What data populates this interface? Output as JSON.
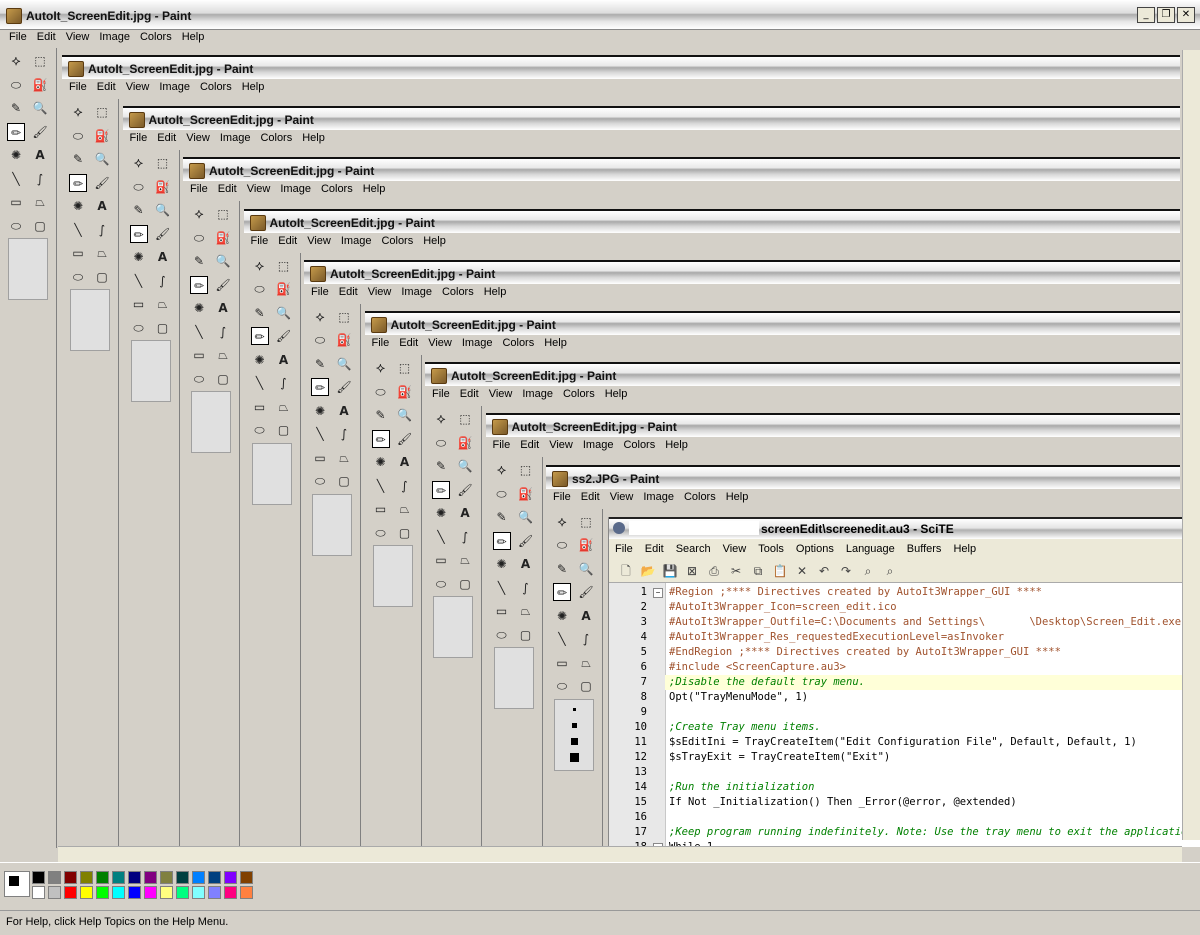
{
  "window": {
    "title": "AutoIt_ScreenEdit.jpg - Paint"
  },
  "menu": [
    "File",
    "Edit",
    "View",
    "Image",
    "Colors",
    "Help"
  ],
  "nested_titles": [
    "AutoIt_ScreenEdit.jpg - Paint",
    "AutoIt_ScreenEdit.jpg - Paint",
    "AutoIt_ScreenEdit.jpg - Paint",
    "AutoIt_ScreenEdit.jpg - Paint",
    "AutoIt_ScreenEdit.jpg - Paint",
    "AutoIt_ScreenEdit.jpg - Paint",
    "AutoIt_ScreenEdit.jpg - Paint",
    "AutoIt_ScreenEdit.jpg - Paint",
    "ss2.JPG - Paint"
  ],
  "scite": {
    "title": "screenEdit\\screenedit.au3 - SciTE",
    "menu": [
      "File",
      "Edit",
      "Search",
      "View",
      "Tools",
      "Options",
      "Language",
      "Buffers",
      "Help"
    ],
    "lines": [
      {
        "n": "1",
        "text": "#Region ;**** Directives created by AutoIt3Wrapper_GUI ****",
        "cls": "c-dir"
      },
      {
        "n": "2",
        "text": "#AutoIt3Wrapper_Icon=screen_edit.ico",
        "cls": "c-dir"
      },
      {
        "n": "3",
        "text": "#AutoIt3Wrapper_Outfile=C:\\Documents and Settings\\       \\Desktop\\Screen_Edit.exe",
        "cls": "c-dir"
      },
      {
        "n": "4",
        "text": "#AutoIt3Wrapper_Res_requestedExecutionLevel=asInvoker",
        "cls": "c-dir"
      },
      {
        "n": "5",
        "text": "#EndRegion ;**** Directives created by AutoIt3Wrapper_GUI ****",
        "cls": "c-dir"
      },
      {
        "n": "6",
        "text": "#include <ScreenCapture.au3>",
        "cls": "c-dir"
      },
      {
        "n": "7",
        "text": ";Disable the default tray menu.",
        "cls": "c-cmt"
      },
      {
        "n": "8",
        "text": "Opt(\"TrayMenuMode\", 1)",
        "cls": "c-txt"
      },
      {
        "n": "9",
        "text": "",
        "cls": "c-txt"
      },
      {
        "n": "10",
        "text": ";Create Tray menu items.",
        "cls": "c-cmt"
      },
      {
        "n": "11",
        "text": "$sEditIni = TrayCreateItem(\"Edit Configuration File\", Default, Default, 1)",
        "cls": "c-txt"
      },
      {
        "n": "12",
        "text": "$sTrayExit = TrayCreateItem(\"Exit\")",
        "cls": "c-txt"
      },
      {
        "n": "13",
        "text": "",
        "cls": "c-txt"
      },
      {
        "n": "14",
        "text": ";Run the initialization",
        "cls": "c-cmt"
      },
      {
        "n": "15",
        "text": "If Not _Initialization() Then _Error(@error, @extended)",
        "cls": "c-txt"
      },
      {
        "n": "16",
        "text": "",
        "cls": "c-txt"
      },
      {
        "n": "17",
        "text": ";Keep program running indefinitely. Note: Use the tray menu to exit the application",
        "cls": "c-cmt"
      },
      {
        "n": "18",
        "text": "While 1",
        "cls": "c-txt"
      }
    ]
  },
  "status_text": "For Help, click Help Topics on the Help Menu.",
  "colors": {
    "palette_top": [
      "#000000",
      "#808080",
      "#800000",
      "#808000",
      "#008000",
      "#008080",
      "#000080",
      "#800080",
      "#808040",
      "#004040",
      "#0080ff",
      "#004080",
      "#8000ff",
      "#804000"
    ],
    "palette_bottom": [
      "#ffffff",
      "#c0c0c0",
      "#ff0000",
      "#ffff00",
      "#00ff00",
      "#00ffff",
      "#0000ff",
      "#ff00ff",
      "#ffff80",
      "#00ff80",
      "#80ffff",
      "#8080ff",
      "#ff0080",
      "#ff8040"
    ]
  }
}
